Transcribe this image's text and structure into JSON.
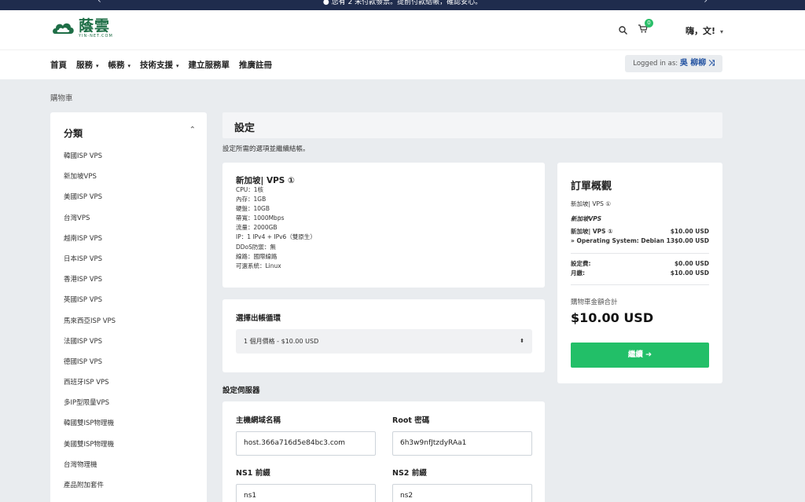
{
  "topbar": {
    "message": "您有 2 未付款發票。提前付款結帳，確認安心。"
  },
  "brand": {
    "name": "蔭雲",
    "tagline": "YIN-NET.COM"
  },
  "header": {
    "cart_count": "0",
    "greeting": "嗨，文!"
  },
  "nav": {
    "items": [
      "首頁",
      "服務",
      "帳務",
      "技術支援",
      "建立服務單",
      "推廣註冊"
    ],
    "login_prefix": "Logged in as:",
    "login_user": "吳 柳柳"
  },
  "breadcrumb": "購物車",
  "sidebar": {
    "title": "分類",
    "items": [
      "韓國ISP VPS",
      "新加坡VPS",
      "美國ISP VPS",
      "台灣VPS",
      "越南ISP VPS",
      "日本ISP VPS",
      "香港ISP VPS",
      "英國ISP VPS",
      "馬來西亞ISP VPS",
      "法國ISP VPS",
      "德國ISP VPS",
      "西班牙ISP VPS",
      "多IP型限量VPS",
      "韓國雙ISP物理機",
      "美國雙ISP物理機",
      "台灣物理機",
      "產品附加套件"
    ]
  },
  "config": {
    "title": "設定",
    "subtitle": "設定所需的選項並繼續結帳。",
    "product_name": "新加坡| VPS ①",
    "specs": [
      "CPU：1核",
      "內存：1GB",
      "硬盤：10GB",
      "帶寬：1000Mbps",
      "流量：2000GB",
      "IP：1 IPv4 + IPv6（雙原生）",
      "DDoS防禦：無",
      "線路：國際線路",
      "可選系統：Linux"
    ],
    "cycle_label": "選擇出帳循環",
    "cycle_value": "1 個月價格 - $10.00 USD",
    "server_label": "設定伺服器",
    "hostname_label": "主機網域名稱",
    "hostname_value": "host.366a716d5e84bc3.com",
    "root_label": "Root 密碼",
    "root_value": "6h3w9nfJtzdyRAa1",
    "ns1_label": "NS1 前綴",
    "ns1_value": "ns1",
    "ns2_label": "NS2 前綴",
    "ns2_value": "ns2"
  },
  "summary": {
    "title": "訂單概觀",
    "group": "新加坡| VPS ①",
    "category": "新加坡VPS",
    "line_name": "新加坡| VPS ①",
    "line_price": "$10.00 USD",
    "os_line": "» Operating System: Debian 13",
    "os_price": "$0.00 USD",
    "setup_label": "設定費:",
    "setup_price": "$0.00 USD",
    "monthly_label": "月繳:",
    "monthly_price": "$10.00 USD",
    "total_label": "購物車金額合計",
    "total": "$10.00 USD",
    "continue_label": "繼續"
  }
}
